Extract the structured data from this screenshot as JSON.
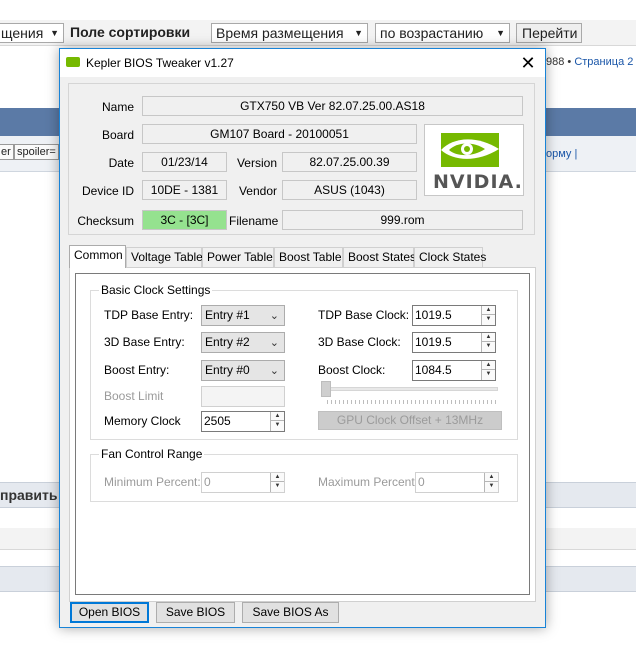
{
  "background": {
    "select1": "щения",
    "sort_label": "Поле сортировки",
    "select2": "Время размещения",
    "select3": "по возрастанию",
    "go_button": "Перейти",
    "nav_number": "988 •",
    "nav_page": "Страница",
    "nav_page_num": "2",
    "chip1": "er",
    "chip2": "spoiler=",
    "link_form": "орму |",
    "band_text": "править"
  },
  "window": {
    "title": "Kepler BIOS Tweaker v1.27",
    "info": {
      "name_label": "Name",
      "name_value": "GTX750 VB Ver 82.07.25.00.AS18",
      "board_label": "Board",
      "board_value": "GM107 Board - 20100051",
      "date_label": "Date",
      "date_value": "01/23/14",
      "version_label": "Version",
      "version_value": "82.07.25.00.39",
      "device_label": "Device ID",
      "device_value": "10DE - 1381",
      "vendor_label": "Vendor",
      "vendor_value": "ASUS (1043)",
      "checksum_label": "Checksum",
      "checksum_value": "3C - [3C]",
      "filename_label": "Filename",
      "filename_value": "999.rom",
      "logo_text": "NVIDIA."
    },
    "tabs": [
      "Common",
      "Voltage Table",
      "Power Table",
      "Boost Table",
      "Boost States",
      "Clock States"
    ],
    "basic": {
      "title": "Basic Clock Settings",
      "tdp_entry_label": "TDP Base Entry:",
      "tdp_entry_value": "Entry #1",
      "d3_entry_label": "3D Base Entry:",
      "d3_entry_value": "Entry #2",
      "boost_entry_label": "Boost Entry:",
      "boost_entry_value": "Entry #0",
      "boost_limit_label": "Boost Limit",
      "memory_label": "Memory Clock",
      "memory_value": "2505",
      "tdp_clock_label": "TDP Base Clock:",
      "tdp_clock_value": "1019.5",
      "d3_clock_label": "3D Base Clock:",
      "d3_clock_value": "1019.5",
      "boost_clock_label": "Boost Clock:",
      "boost_clock_value": "1084.5",
      "offset_button": "GPU Clock Offset + 13MHz"
    },
    "fan": {
      "title": "Fan Control Range",
      "min_label": "Minimum Percent:",
      "min_value": "0",
      "max_label": "Maximum Percent:",
      "max_value": "0"
    },
    "buttons": {
      "open": "Open BIOS",
      "save": "Save BIOS",
      "save_as": "Save BIOS As"
    }
  }
}
